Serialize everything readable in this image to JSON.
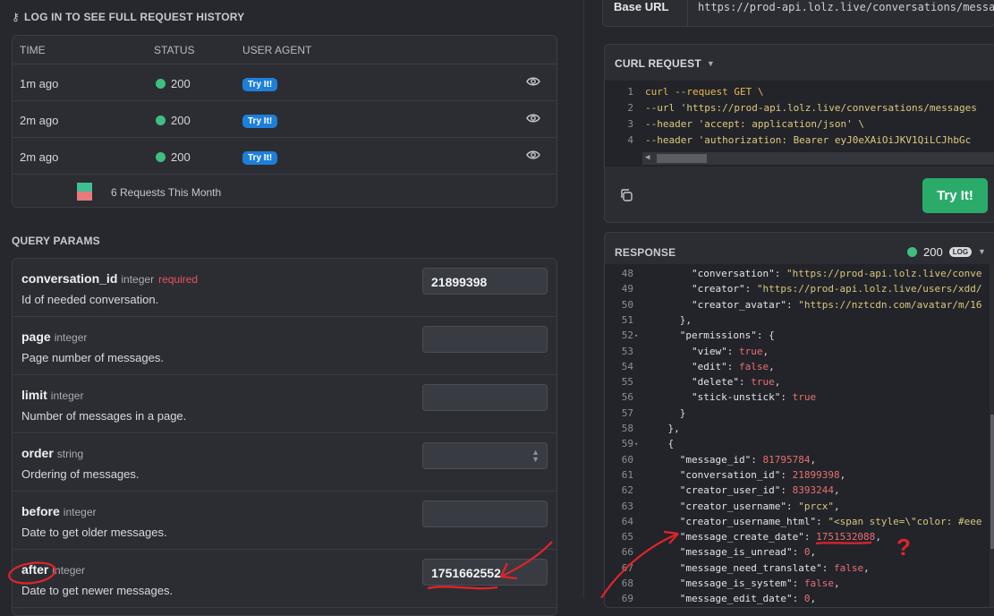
{
  "history": {
    "title": "LOG IN TO SEE FULL REQUEST HISTORY",
    "columns": [
      "TIME",
      "STATUS",
      "USER AGENT"
    ],
    "rows": [
      {
        "time": "1m ago",
        "status": "200",
        "agent": "Try It!"
      },
      {
        "time": "2m ago",
        "status": "200",
        "agent": "Try It!"
      },
      {
        "time": "2m ago",
        "status": "200",
        "agent": "Try It!"
      }
    ],
    "footer": "6 Requests This Month",
    "colors": {
      "success": "#3fbf94",
      "error": "#e77b7b"
    }
  },
  "query_params": {
    "title": "QUERY PARAMS",
    "params": [
      {
        "name": "conversation_id",
        "type": "integer",
        "required": "required",
        "desc": "Id of needed conversation.",
        "value": "21899398"
      },
      {
        "name": "page",
        "type": "integer",
        "required": "",
        "desc": "Page number of messages.",
        "value": ""
      },
      {
        "name": "limit",
        "type": "integer",
        "required": "",
        "desc": "Number of messages in a page.",
        "value": ""
      },
      {
        "name": "order",
        "type": "string",
        "required": "",
        "desc": "Ordering of messages.",
        "value": ""
      },
      {
        "name": "before",
        "type": "integer",
        "required": "",
        "desc": "Date to get older messages.",
        "value": ""
      },
      {
        "name": "after",
        "type": "integer",
        "required": "",
        "desc": "Date to get newer messages.",
        "value": "1751662552"
      }
    ]
  },
  "base_url": {
    "label": "Base URL",
    "value": "https://prod-api.lolz.live/conversations/messages"
  },
  "curl": {
    "title": "CURL REQUEST",
    "lines": [
      {
        "n": "1",
        "text": "curl --request GET \\"
      },
      {
        "n": "2",
        "text": "     --url 'https://prod-api.lolz.live/conversations/messages"
      },
      {
        "n": "3",
        "text": "     --header 'accept: application/json' \\"
      },
      {
        "n": "4",
        "text": "     --header 'authorization: Bearer eyJ0eXAiOiJKV1QiLCJhbGc"
      }
    ],
    "try_label": "Try It!"
  },
  "response": {
    "title": "RESPONSE",
    "status": "200",
    "badge": "LOG",
    "lines": [
      {
        "n": "48",
        "fold": "",
        "html": "        <span class='k'>\"conversation\"</span>: <span class='s'>\"https://prod-api.lolz.live/conve</span>"
      },
      {
        "n": "49",
        "fold": "",
        "html": "        <span class='k'>\"creator\"</span>: <span class='s'>\"https://prod-api.lolz.live/users/xdd/</span>"
      },
      {
        "n": "50",
        "fold": "",
        "html": "        <span class='k'>\"creator_avatar\"</span>: <span class='s'>\"https://nztcdn.com/avatar/m/16</span>"
      },
      {
        "n": "51",
        "fold": "",
        "html": "      },"
      },
      {
        "n": "52",
        "fold": "▾",
        "html": "      <span class='k'>\"permissions\"</span>: {"
      },
      {
        "n": "53",
        "fold": "",
        "html": "        <span class='k'>\"view\"</span>: <span class='b'>true</span>,"
      },
      {
        "n": "54",
        "fold": "",
        "html": "        <span class='k'>\"edit\"</span>: <span class='b'>false</span>,"
      },
      {
        "n": "55",
        "fold": "",
        "html": "        <span class='k'>\"delete\"</span>: <span class='b'>true</span>,"
      },
      {
        "n": "56",
        "fold": "",
        "html": "        <span class='k'>\"stick-unstick\"</span>: <span class='b'>true</span>"
      },
      {
        "n": "57",
        "fold": "",
        "html": "      }"
      },
      {
        "n": "58",
        "fold": "",
        "html": "    },"
      },
      {
        "n": "59",
        "fold": "▾",
        "html": "    {"
      },
      {
        "n": "60",
        "fold": "",
        "html": "      <span class='k'>\"message_id\"</span>: <span class='n'>81795784</span>,"
      },
      {
        "n": "61",
        "fold": "",
        "html": "      <span class='k'>\"conversation_id\"</span>: <span class='n'>21899398</span>,"
      },
      {
        "n": "62",
        "fold": "",
        "html": "      <span class='k'>\"creator_user_id\"</span>: <span class='n'>8393244</span>,"
      },
      {
        "n": "63",
        "fold": "",
        "html": "      <span class='k'>\"creator_username\"</span>: <span class='s'>\"prcx\"</span>,"
      },
      {
        "n": "64",
        "fold": "",
        "html": "      <span class='k'>\"creator_username_html\"</span>: <span class='s'>\"&lt;span style=\\\"color: #eee</span>"
      },
      {
        "n": "65",
        "fold": "",
        "html": "      <span class='k'>\"message_create_date\"</span>: <span class='n'>1751532088</span>,"
      },
      {
        "n": "66",
        "fold": "",
        "html": "      <span class='k'>\"message_is_unread\"</span>: <span class='n'>0</span>,"
      },
      {
        "n": "67",
        "fold": "",
        "html": "      <span class='k'>\"message_need_translate\"</span>: <span class='b'>false</span>,"
      },
      {
        "n": "68",
        "fold": "",
        "html": "      <span class='k'>\"message_is_system\"</span>: <span class='b'>false</span>,"
      },
      {
        "n": "69",
        "fold": "",
        "html": "      <span class='k'>\"message_edit_date\"</span>: <span class='n'>0</span>,"
      }
    ]
  },
  "annotation": {
    "mark": "?"
  }
}
